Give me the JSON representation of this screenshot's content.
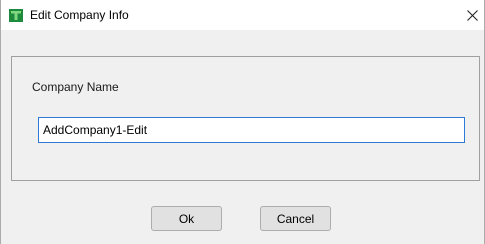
{
  "window": {
    "title": "Edit Company Info",
    "app_icon": "app-icon",
    "close_icon": "close-icon",
    "accent_color": "#2a7ad6",
    "icon_color": "#1e8a3c"
  },
  "form": {
    "company_name_label": "Company Name",
    "company_name_value": "AddCompany1-Edit"
  },
  "buttons": {
    "ok_label": "Ok",
    "cancel_label": "Cancel"
  }
}
